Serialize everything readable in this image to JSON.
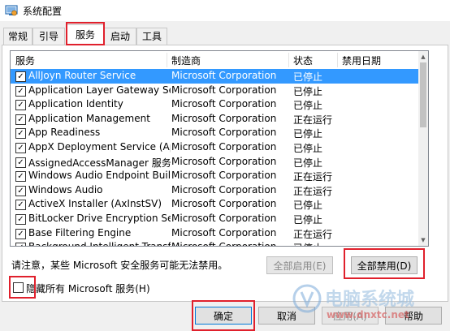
{
  "window": {
    "title": "系统配置"
  },
  "tabs": [
    {
      "label": "常规"
    },
    {
      "label": "引导"
    },
    {
      "label": "服务"
    },
    {
      "label": "启动"
    },
    {
      "label": "工具"
    }
  ],
  "table": {
    "columns": [
      "服务",
      "制造商",
      "状态",
      "禁用日期"
    ],
    "rows": [
      {
        "service": "AllJoyn Router Service",
        "maker": "Microsoft Corporation",
        "status": "已停止",
        "selected": true
      },
      {
        "service": "Application Layer Gateway Service",
        "maker": "Microsoft Corporation",
        "status": "已停止"
      },
      {
        "service": "Application Identity",
        "maker": "Microsoft Corporation",
        "status": "已停止"
      },
      {
        "service": "Application Management",
        "maker": "Microsoft Corporation",
        "status": "正在运行"
      },
      {
        "service": "App Readiness",
        "maker": "Microsoft Corporation",
        "status": "已停止"
      },
      {
        "service": "AppX Deployment Service (AppX...",
        "maker": "Microsoft Corporation",
        "status": "已停止"
      },
      {
        "service": "AssignedAccessManager 服务",
        "maker": "Microsoft Corporation",
        "status": "已停止"
      },
      {
        "service": "Windows Audio Endpoint Builder",
        "maker": "Microsoft Corporation",
        "status": "正在运行"
      },
      {
        "service": "Windows Audio",
        "maker": "Microsoft Corporation",
        "status": "正在运行"
      },
      {
        "service": "ActiveX Installer (AxInstSV)",
        "maker": "Microsoft Corporation",
        "status": "已停止"
      },
      {
        "service": "BitLocker Drive Encryption Service",
        "maker": "Microsoft Corporation",
        "status": "已停止"
      },
      {
        "service": "Base Filtering Engine",
        "maker": "Microsoft Corporation",
        "status": "正在运行"
      },
      {
        "service": "Background Intelligent Transfer ...",
        "maker": "Microsoft Corporation",
        "status": "已停止"
      }
    ],
    "checkbox_mark": "✓"
  },
  "note": "请注意，某些 Microsoft 安全服务可能无法禁用。",
  "buttons": {
    "enable_all": "全部启用(E)",
    "disable_all": "全部禁用(D)",
    "ok": "确定",
    "cancel": "取消",
    "apply": "应用(A)",
    "help": "帮助"
  },
  "hide_ms": "隐藏所有 Microsoft 服务(H)",
  "watermark": {
    "brand": "电脑系统城",
    "url": "www.dnxtc.net"
  },
  "colors": {
    "highlight": "#e0202c",
    "selection": "#3399ff"
  }
}
